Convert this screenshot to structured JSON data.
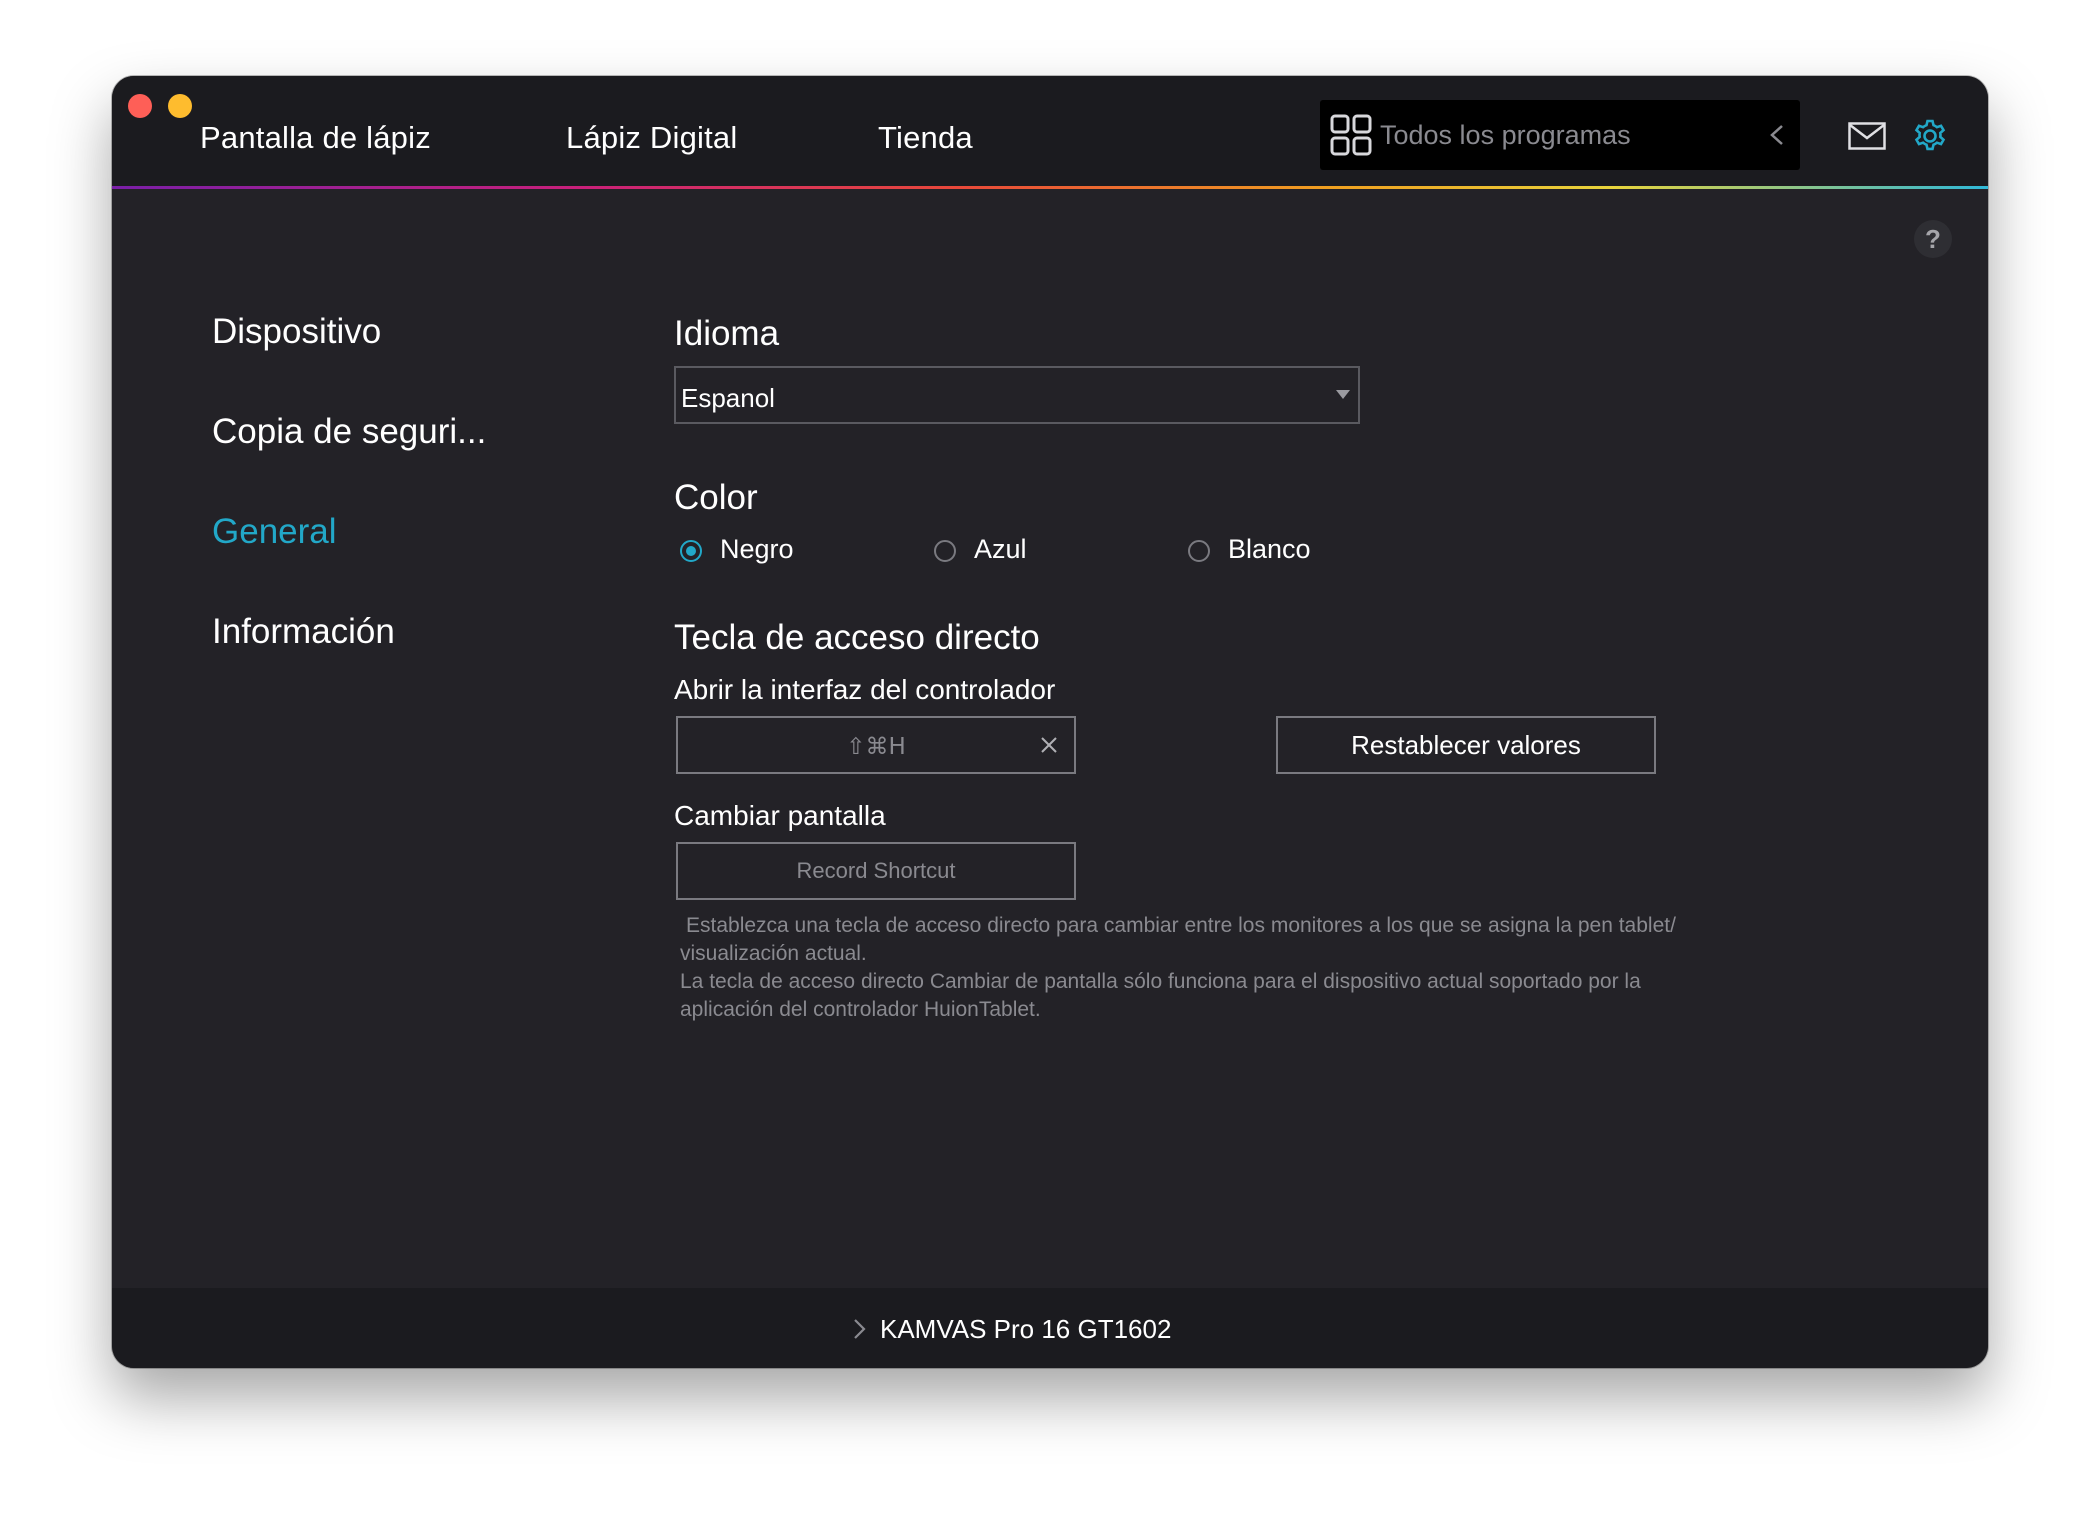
{
  "window": {
    "colors": {
      "background": "#232227",
      "titlebar": "#1b1b1f",
      "accent": "#22a8c8",
      "traffic_red": "#fe5f57",
      "traffic_yellow": "#febc2e"
    }
  },
  "topnav": {
    "items": [
      {
        "label": "Pantalla de lápiz"
      },
      {
        "label": "Lápiz Digital"
      },
      {
        "label": "Tienda"
      }
    ]
  },
  "program_select": {
    "label": "Todos los programas",
    "icon": "grid-icon"
  },
  "header_icons": {
    "mail": "mail-icon",
    "settings": "gear-icon",
    "help": "?"
  },
  "sidebar": {
    "items": [
      {
        "label": "Dispositivo"
      },
      {
        "label": "Copia de seguri..."
      },
      {
        "label": "General",
        "selected": true
      },
      {
        "label": "Información"
      }
    ]
  },
  "general": {
    "language": {
      "title": "Idioma",
      "value": "Espanol"
    },
    "color": {
      "title": "Color",
      "options": [
        {
          "label": "Negro",
          "checked": true
        },
        {
          "label": "Azul",
          "checked": false
        },
        {
          "label": "Blanco",
          "checked": false
        }
      ]
    },
    "hotkeys": {
      "title": "Tecla de acceso directo",
      "open_driver_label": "Abrir la interfaz del controlador",
      "open_driver_value": "⇧⌘H",
      "reset_label": "Restablecer valores",
      "switch_screen_label": "Cambiar pantalla",
      "record_label": "Record Shortcut",
      "desc_line1": "Establezca una tecla de acceso directo para cambiar entre los monitores a los que se asigna la pen tablet/",
      "desc_line2": "visualización actual.",
      "desc_line3": "La tecla de acceso directo Cambiar de pantalla sólo funciona para el dispositivo actual soportado por la",
      "desc_line4": "aplicación del controlador HuionTablet."
    }
  },
  "footer": {
    "device": "KAMVAS Pro 16 GT1602"
  }
}
